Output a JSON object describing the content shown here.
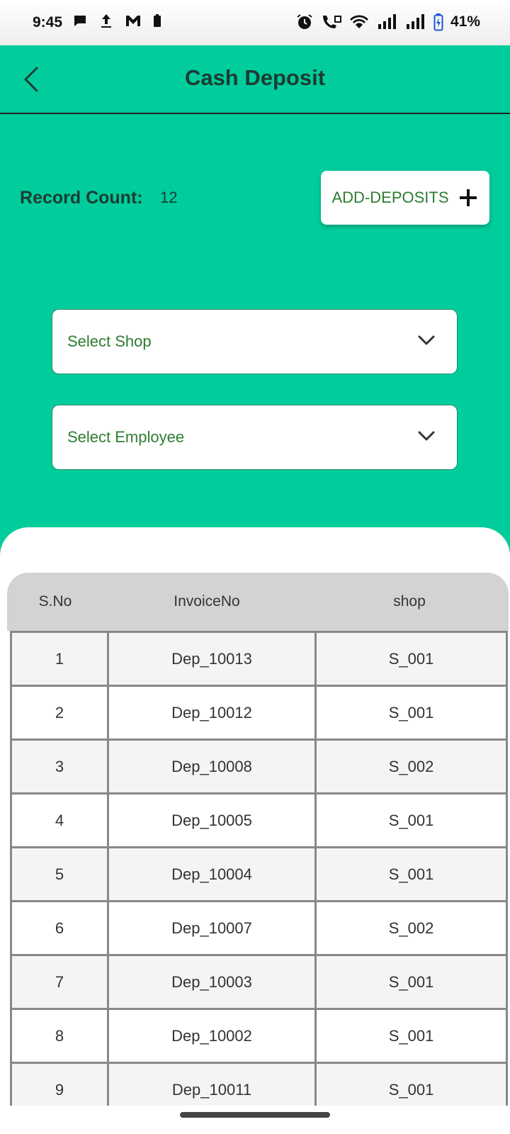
{
  "status_bar": {
    "time": "9:45",
    "battery_percent": "41%",
    "left_icons": [
      "chat-icon",
      "upload-icon",
      "gmail-icon",
      "battery-small-icon"
    ],
    "right_icons": [
      "alarm-icon",
      "wifi-call-icon",
      "wifi-icon",
      "signal-icon",
      "signal-icon",
      "battery-charging-icon"
    ]
  },
  "app_bar": {
    "title": "Cash Deposit",
    "back_icon": "chevron-left-icon"
  },
  "summary": {
    "record_count_label": "Record Count:",
    "record_count_value": "12",
    "add_button_label": "ADD-DEPOSITS",
    "add_icon": "plus-icon"
  },
  "filters": {
    "shop_placeholder": "Select Shop",
    "employee_placeholder": "Select Employee"
  },
  "table": {
    "headers": [
      "S.No",
      "InvoiceNo",
      "shop"
    ],
    "rows": [
      {
        "sno": "1",
        "invoice": "Dep_10013",
        "shop": "S_001"
      },
      {
        "sno": "2",
        "invoice": "Dep_10012",
        "shop": "S_001"
      },
      {
        "sno": "3",
        "invoice": "Dep_10008",
        "shop": "S_002"
      },
      {
        "sno": "4",
        "invoice": "Dep_10005",
        "shop": "S_001"
      },
      {
        "sno": "5",
        "invoice": "Dep_10004",
        "shop": "S_001"
      },
      {
        "sno": "6",
        "invoice": "Dep_10007",
        "shop": "S_002"
      },
      {
        "sno": "7",
        "invoice": "Dep_10003",
        "shop": "S_001"
      },
      {
        "sno": "8",
        "invoice": "Dep_10002",
        "shop": "S_001"
      },
      {
        "sno": "9",
        "invoice": "Dep_10011",
        "shop": "S_001"
      }
    ]
  },
  "colors": {
    "primary": "#00cc9c",
    "title_text": "#1d3b32",
    "accent_text": "#2e7d32",
    "header_bg": "#d3d3d3"
  }
}
